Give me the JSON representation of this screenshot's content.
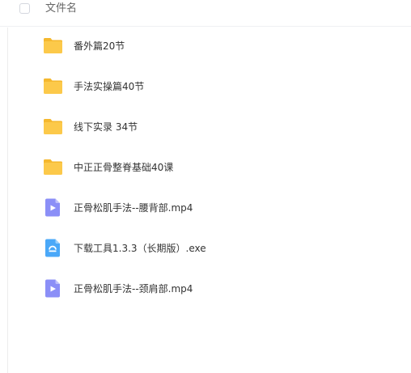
{
  "header": {
    "column_label": "文件名"
  },
  "files": [
    {
      "name": "番外篇20节",
      "icon": "folder-icon"
    },
    {
      "name": "手法实操篇40节",
      "icon": "folder-icon"
    },
    {
      "name": "线下实录 34节",
      "icon": "folder-icon"
    },
    {
      "name": "中正正骨整脊基础40课",
      "icon": "folder-icon"
    },
    {
      "name": "正骨松肌手法--腰背部.mp4",
      "icon": "video-file-icon"
    },
    {
      "name": "下载工具1.3.3（长期版）.exe",
      "icon": "exe-file-icon"
    },
    {
      "name": "正骨松肌手法--颈肩部.mp4",
      "icon": "video-file-icon"
    }
  ],
  "colors": {
    "folder": "#fcc94a",
    "folder_tab": "#f5b82e",
    "video_file": "#8b8ff7",
    "exe_file": "#4aa8f8"
  }
}
